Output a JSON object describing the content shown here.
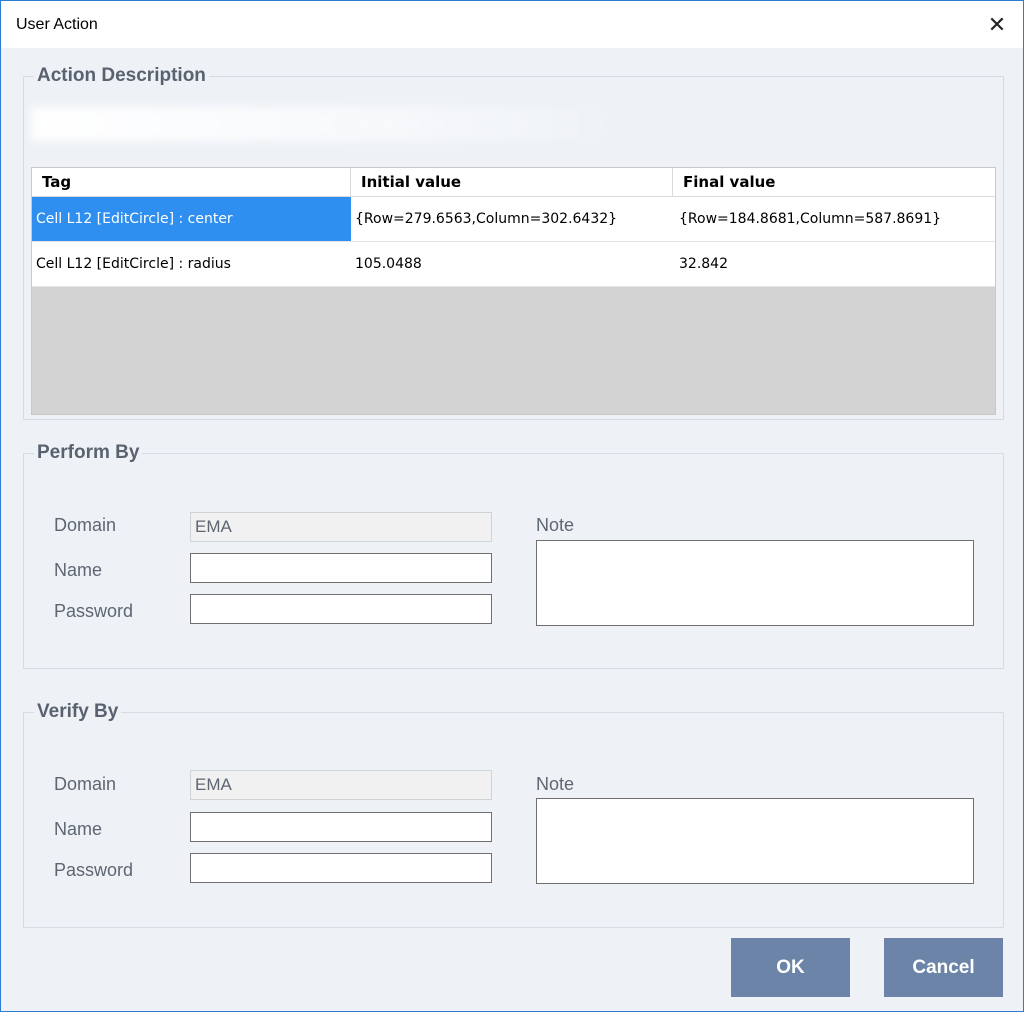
{
  "window": {
    "title": "User Action",
    "close_glyph": "✕"
  },
  "action_description": {
    "title": "Action Description",
    "table": {
      "columns": [
        "Tag",
        "Initial value",
        "Final value"
      ],
      "rows": [
        {
          "tag": "Cell L12 [EditCircle] : center",
          "initial": "{Row=279.6563,Column=302.6432}",
          "final": "{Row=184.8681,Column=587.8691}",
          "selected": true
        },
        {
          "tag": "Cell L12 [EditCircle] : radius",
          "initial": "105.0488",
          "final": "32.842",
          "selected": false
        }
      ]
    }
  },
  "perform_by": {
    "title": "Perform By",
    "domain_label": "Domain",
    "domain_value": "EMA",
    "name_label": "Name",
    "name_value": "",
    "password_label": "Password",
    "password_value": "",
    "note_label": "Note",
    "note_value": ""
  },
  "verify_by": {
    "title": "Verify By",
    "domain_label": "Domain",
    "domain_value": "EMA",
    "name_label": "Name",
    "name_value": "",
    "password_label": "Password",
    "password_value": "",
    "note_label": "Note",
    "note_value": ""
  },
  "buttons": {
    "ok": "OK",
    "cancel": "Cancel"
  },
  "colors": {
    "accent": "#2e8ff0",
    "button": "#6b84a8",
    "background": "#eef2f7"
  }
}
